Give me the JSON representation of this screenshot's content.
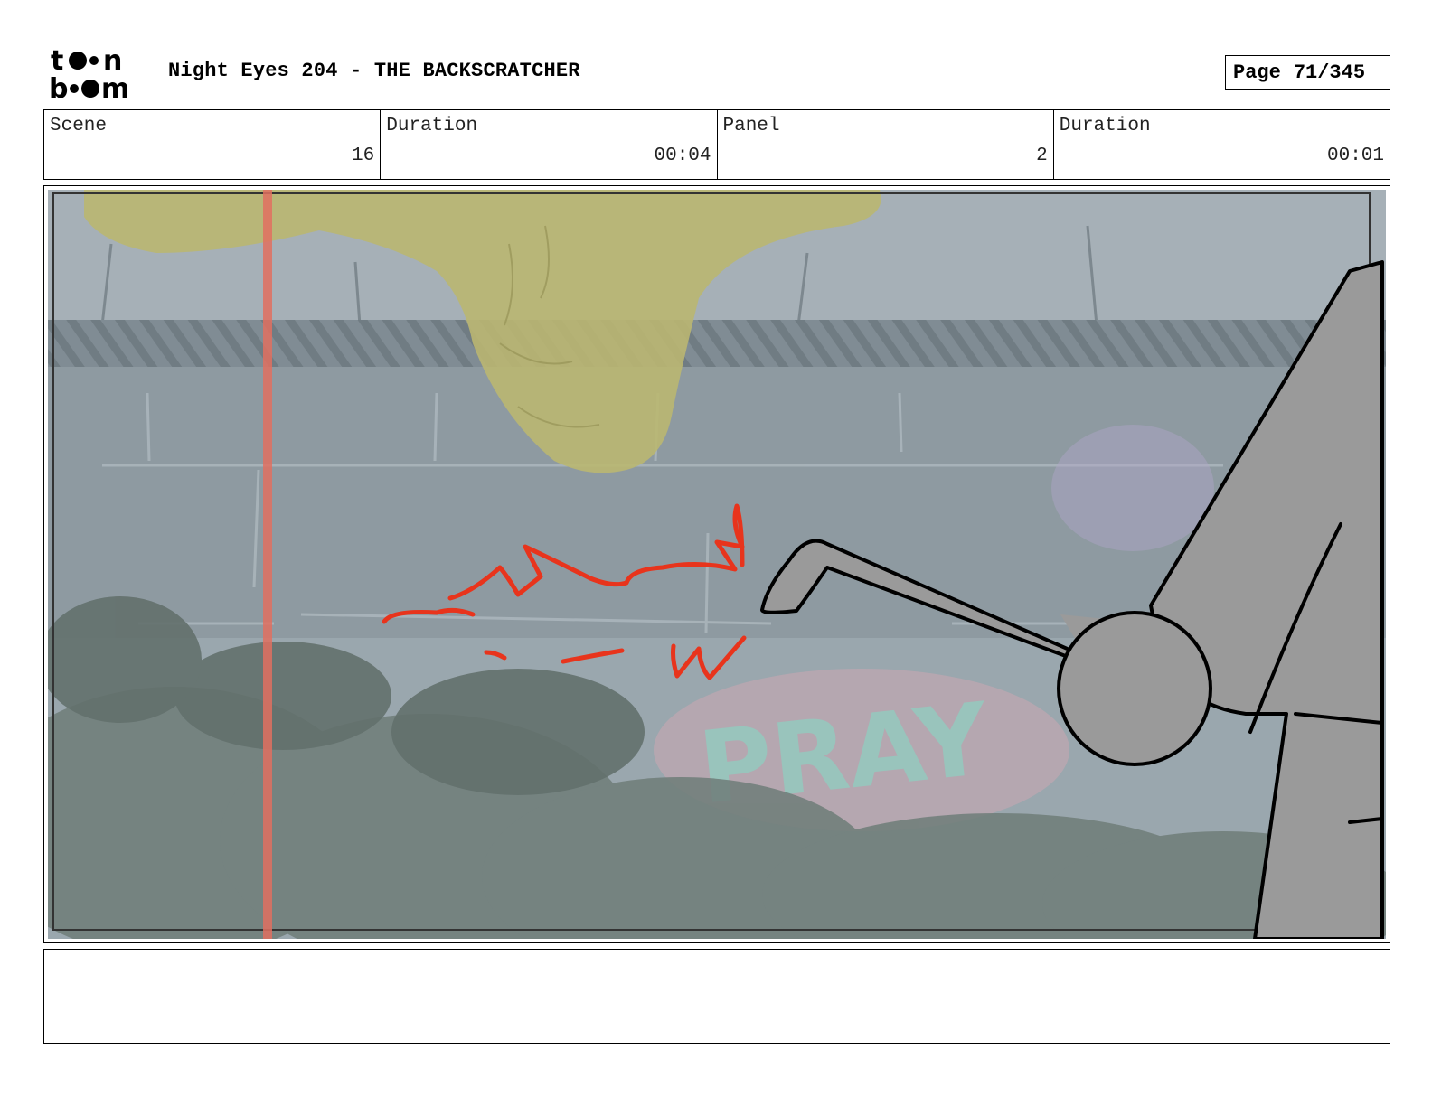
{
  "header": {
    "logo_text": "toon boom",
    "title": "Night Eyes 204 - THE BACKSCRATCHER",
    "page_label": "Page",
    "page_number": "71/345"
  },
  "info": {
    "scene_label": "Scene",
    "scene_value": "16",
    "scene_duration_label": "Duration",
    "scene_duration_value": "00:04",
    "panel_label": "Panel",
    "panel_value": "2",
    "panel_duration_label": "Duration",
    "panel_duration_value": "00:01"
  },
  "panel_image": {
    "graffiti_text": "PRAY"
  },
  "notes": {
    "text": ""
  },
  "colors": {
    "sketch_red": "#e8341c",
    "sketch_gray": "#9a9a9a",
    "bg_wall": "#8a9aa3",
    "slime": "#b8b35a",
    "safe_line": "#e07060"
  }
}
